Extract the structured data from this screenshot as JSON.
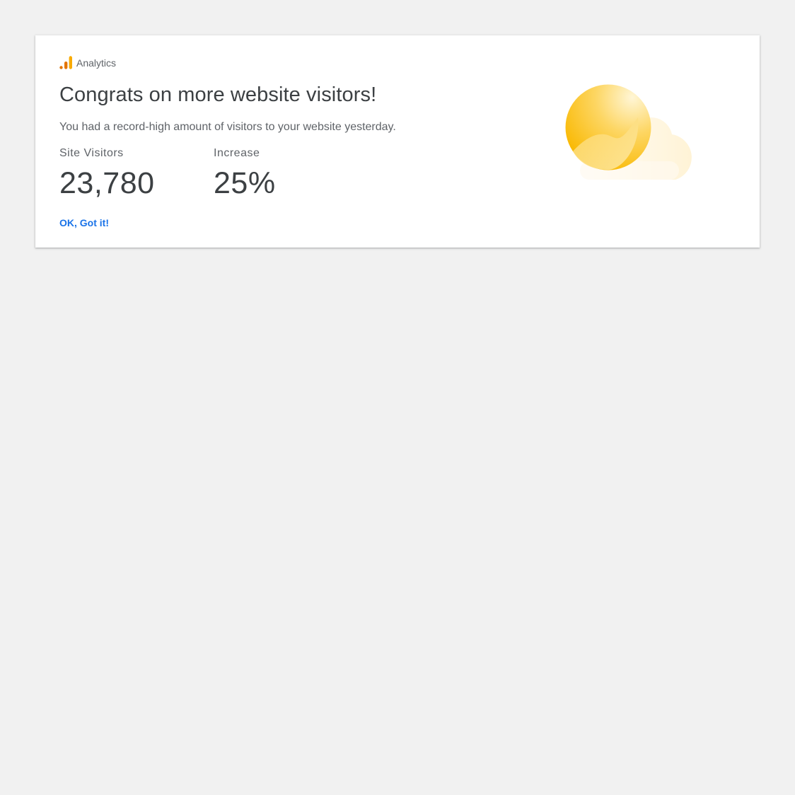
{
  "app": {
    "name": "Analytics",
    "icon": "analytics-bars-icon",
    "brand_colors": [
      "#f9ab00",
      "#e37400"
    ]
  },
  "card": {
    "title": "Congrats on more website visitors!",
    "description": "You had a record-high amount of visitors to your website yesterday.",
    "metrics": [
      {
        "label": "Site Visitors",
        "value": "23,780"
      },
      {
        "label": "Increase",
        "value": "25%"
      }
    ],
    "action_label": "OK, Got it!",
    "action_color": "#1a73e8",
    "illustration": "sun-behind-cloud-icon"
  }
}
